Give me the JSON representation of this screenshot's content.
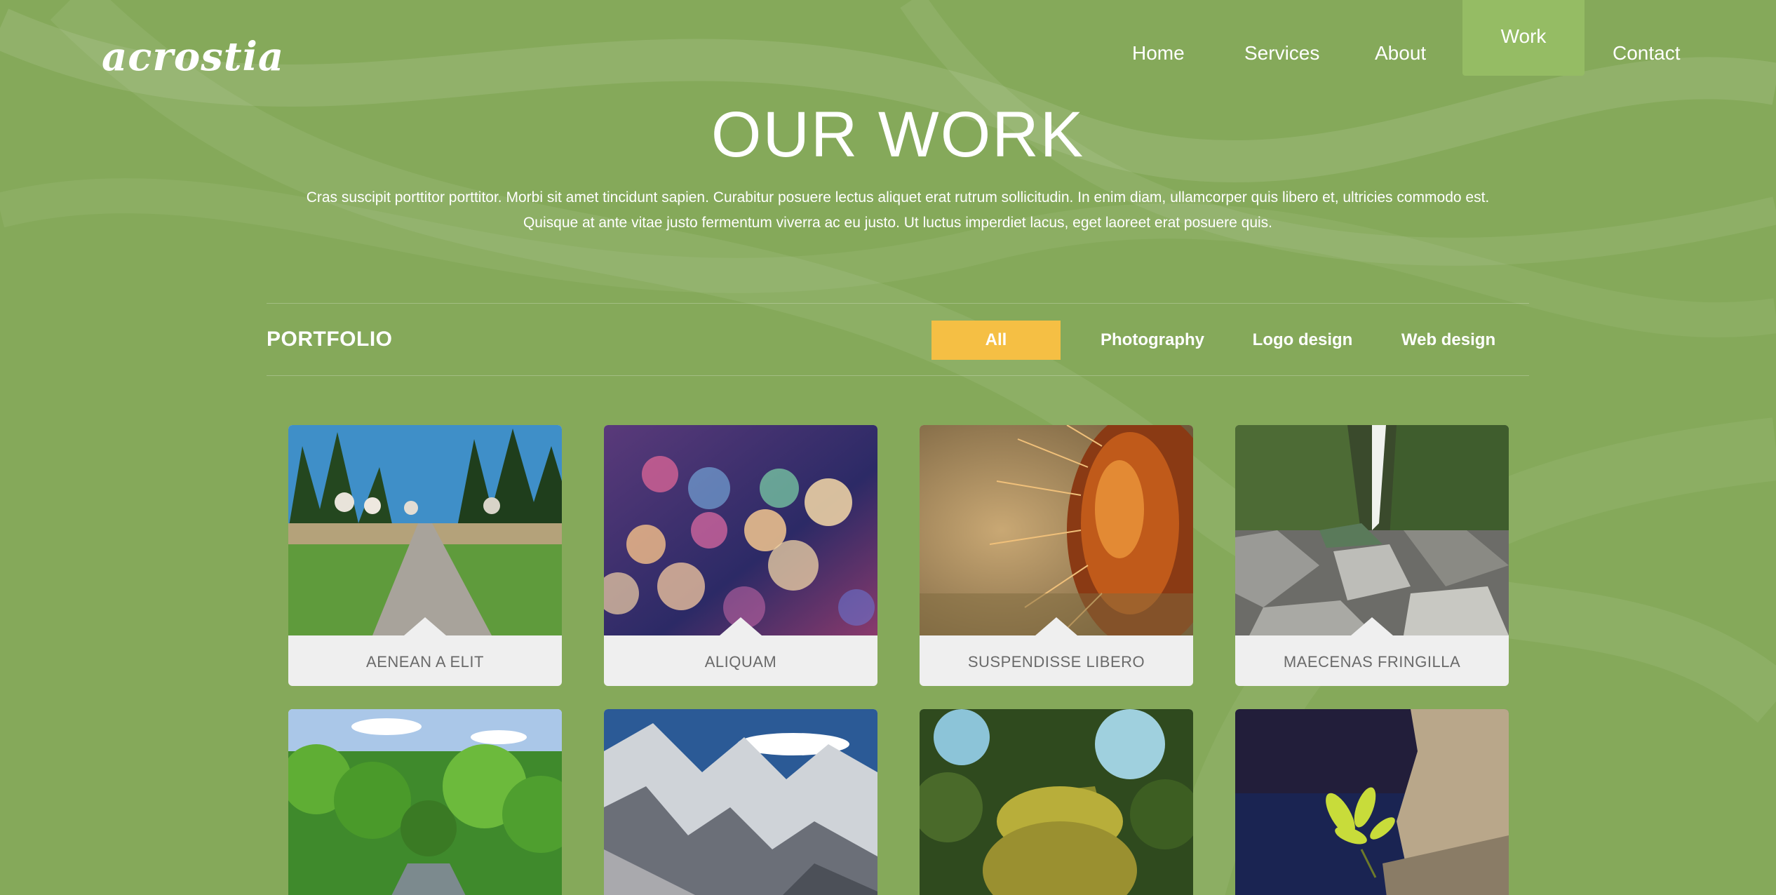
{
  "brand": {
    "logo_text": "acrostia"
  },
  "nav": {
    "items": [
      {
        "label": "Home"
      },
      {
        "label": "Services"
      },
      {
        "label": "About"
      },
      {
        "label": "Work",
        "active": true
      },
      {
        "label": "Contact"
      }
    ]
  },
  "hero": {
    "title": "OUR WORK",
    "intro_line1": "Cras suscipit porttitor porttitor. Morbi sit amet tincidunt sapien. Curabitur posuere lectus aliquet erat rutrum sollicitudin. In enim diam, ullamcorper quis libero et, ultricies commodo est.",
    "intro_line2": "Quisque at ante vitae justo fermentum viverra ac eu justo. Ut luctus imperdiet lacus, eget laoreet erat posuere quis."
  },
  "portfolio": {
    "heading": "PORTFOLIO",
    "filters": [
      {
        "label": "All",
        "active": true
      },
      {
        "label": "Photography"
      },
      {
        "label": "Logo design"
      },
      {
        "label": "Web design"
      }
    ],
    "items": [
      {
        "caption": "AENEAN A ELIT",
        "image": "forest-path-photo"
      },
      {
        "caption": "ALIQUAM",
        "image": "bokeh-lights-photo"
      },
      {
        "caption": "SUSPENDISSE LIBERO",
        "image": "cactus-closeup-photo"
      },
      {
        "caption": "MAECENAS FRINGILLA",
        "image": "waterfall-rocks-photo"
      },
      {
        "caption": "",
        "image": "green-valley-river-photo"
      },
      {
        "caption": "",
        "image": "snowy-mountains-photo"
      },
      {
        "caption": "",
        "image": "mossy-tree-trunk-photo"
      },
      {
        "caption": "",
        "image": "sprout-on-rock-photo"
      }
    ]
  },
  "colors": {
    "background": "#85a95a",
    "nav_active": "#95bc64",
    "filter_active": "#f5bf44",
    "card_bg": "#efefef",
    "caption_text": "#6a6a6a"
  }
}
